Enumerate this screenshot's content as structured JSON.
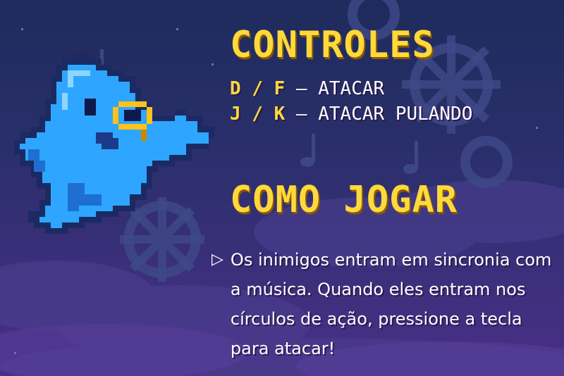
{
  "controls": {
    "title": "CONTROLES",
    "lines": [
      {
        "keys": "D / F",
        "action": " – ATACAR"
      },
      {
        "keys": "J / K",
        "action": " – ATACAR PULANDO"
      }
    ]
  },
  "howto": {
    "title": "COMO JOGAR",
    "text": "Os inimigos entram em sincronia com a música. Quando eles entram nos círculos de ação, pressione a tecla para atacar!"
  },
  "icons": [
    "ghost-icon",
    "gear-icon",
    "music-note-icon",
    "play-triangle-icon"
  ],
  "colors": {
    "accent": "#ffd93b",
    "ghost": "#2ea6ff",
    "bg": "#2a2f6b"
  }
}
